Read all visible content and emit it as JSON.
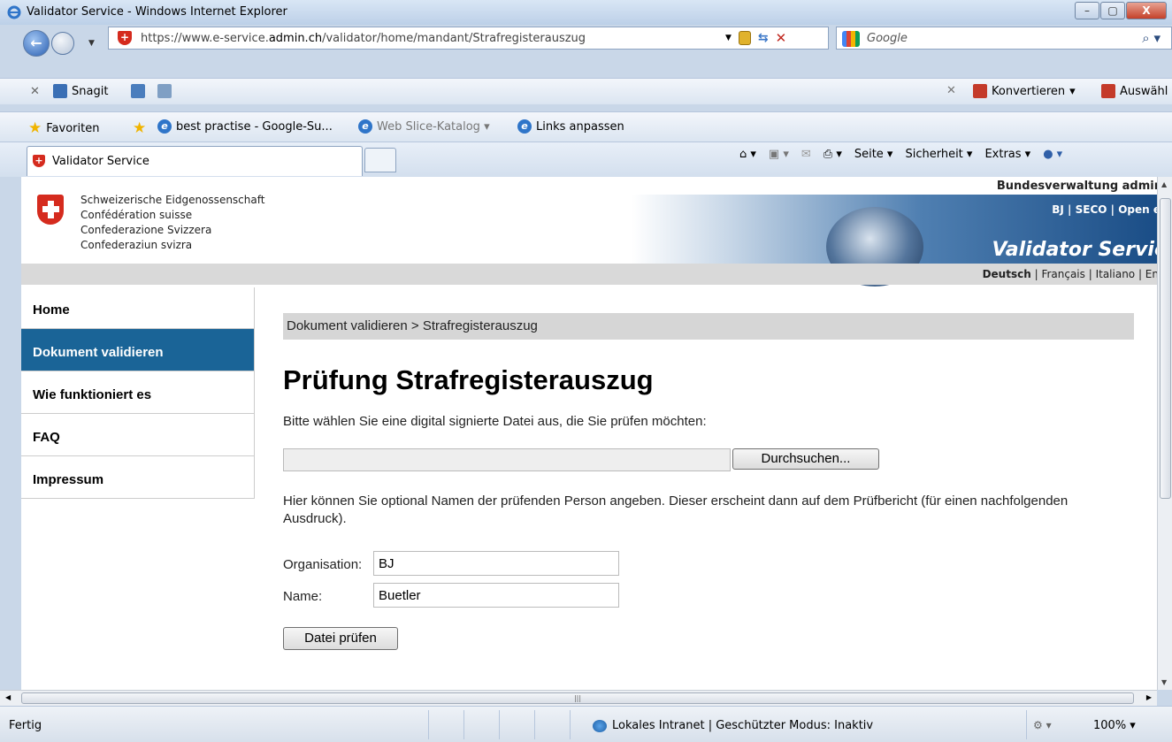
{
  "window": {
    "title": "Validator Service - Windows Internet Explorer",
    "minimize": "–",
    "maximize": "▢",
    "close": "X"
  },
  "address_bar": {
    "url_prefix": "https://www.e-service.",
    "url_domain": "admin.ch",
    "url_path": "/validator/home/mandant/Strafregisterauszug",
    "search_placeholder": "Google"
  },
  "toolbar1": {
    "snagit": "Snagit",
    "konvertieren": "Konvertieren",
    "auswahl": "Auswähl"
  },
  "favorites_bar": {
    "favoriten": "Favoriten",
    "items": [
      "best practise - Google-Su...",
      "Web Slice-Katalog ▾",
      "Links anpassen"
    ]
  },
  "tab": {
    "label": "Validator Service"
  },
  "command_bar": {
    "items": [
      "Seite ▾",
      "Sicherheit ▾",
      "Extras ▾"
    ]
  },
  "page_header": {
    "confed_lines": [
      "Schweizerische Eidgenossenschaft",
      "Confédération suisse",
      "Confederazione Svizzera",
      "Confederaziun svizra"
    ],
    "bv_admin": "Bundesverwaltung admin",
    "svc_links": "BJ | SECO | Open e",
    "svc_title": "Validator Servic",
    "lang_active": "Deutsch",
    "lang_others": " | Français | Italiano | En"
  },
  "sidenav": {
    "items": [
      {
        "label": "Home",
        "active": false
      },
      {
        "label": "Dokument validieren",
        "active": true
      },
      {
        "label": "Wie funktioniert es",
        "active": false
      },
      {
        "label": "FAQ",
        "active": false
      },
      {
        "label": "Impressum",
        "active": false
      }
    ]
  },
  "main": {
    "breadcrumb": "Dokument validieren > Strafregisterauszug",
    "title": "Prüfung Strafregisterauszug",
    "intro": "Bitte wählen Sie eine digital signierte Datei aus, die Sie prüfen möchten:",
    "browse_label": "Durchsuchen...",
    "optional_text": "Hier können Sie optional Namen der prüfenden Person angeben. Dieser erscheint dann auf dem Prüfbericht (für einen nachfolgenden Ausdruck).",
    "org_label": "Organisation:",
    "org_value": "BJ",
    "name_label": "Name:",
    "name_value": "Buetler",
    "submit_label": "Datei prüfen"
  },
  "status_bar": {
    "status": "Fertig",
    "zone": "Lokales Intranet | Geschützter Modus: Inaktiv",
    "zoom": "100%  ▾"
  },
  "colors": {
    "nav_active_bg": "#1a6497",
    "swiss_red": "#d52b1e",
    "breadcrumb_bg": "#d6d6d6"
  }
}
